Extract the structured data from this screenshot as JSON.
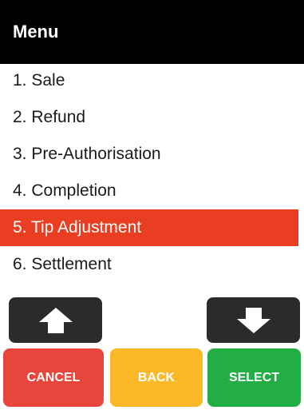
{
  "header": {
    "title": "Menu"
  },
  "menu": {
    "items": [
      {
        "label": "1. Sale"
      },
      {
        "label": "2. Refund"
      },
      {
        "label": "3. Pre-Authorisation"
      },
      {
        "label": "4. Completion"
      },
      {
        "label": "5. Tip Adjustment"
      },
      {
        "label": "6. Settlement"
      }
    ],
    "selected_index": 4
  },
  "nav": {
    "up_icon": "arrow-up-icon",
    "down_icon": "arrow-down-icon"
  },
  "actions": {
    "cancel_label": "CANCEL",
    "back_label": "BACK",
    "select_label": "SELECT"
  },
  "colors": {
    "header_bg": "#000000",
    "selected_bg": "#ea3e22",
    "arrow_bg": "#2b2b2b",
    "cancel": "#e8453c",
    "back": "#fbb829",
    "select": "#22ad45"
  }
}
